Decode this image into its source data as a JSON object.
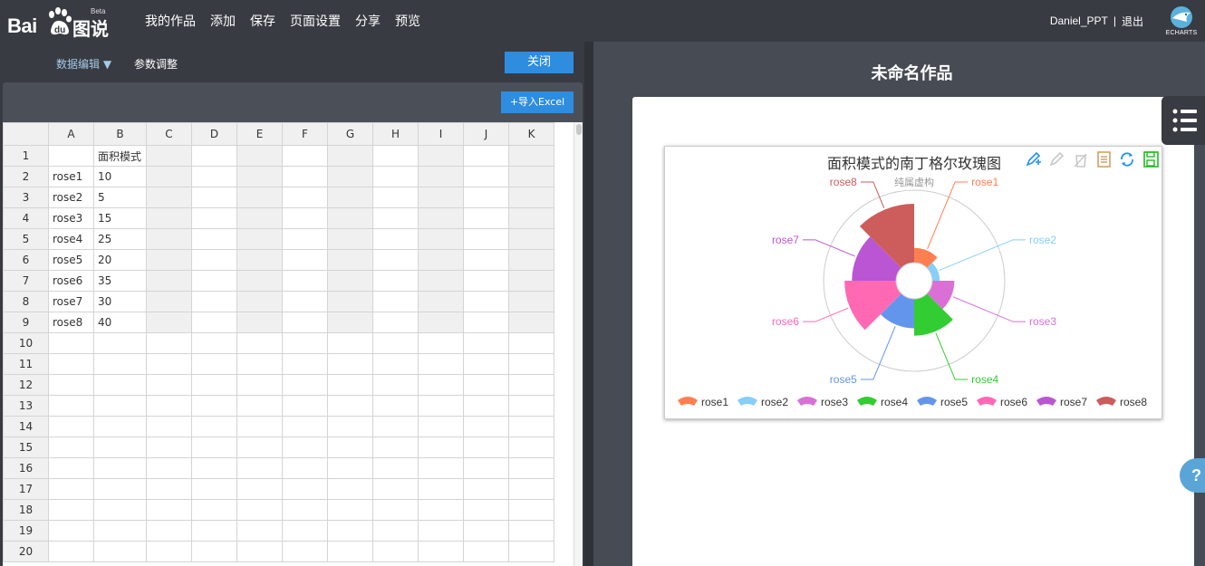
{
  "app": {
    "logo_baidu": "Bai",
    "logo_tushuo": "图说",
    "logo_beta": "Beta",
    "nav": [
      "我的作品",
      "添加",
      "保存",
      "页面设置",
      "分享",
      "预览"
    ],
    "user_name": "Daniel_PPT",
    "user_sep": "|",
    "logout_label": "退出",
    "echarts_label": "ECHARTS"
  },
  "editor": {
    "tab_data_label": "数据编辑",
    "tab_data_caret": "▼",
    "tab_param_label": "参数调整",
    "close_label": "关闭",
    "import_label": "+导入Excel"
  },
  "sheet": {
    "columns": [
      "",
      "A",
      "B",
      "C",
      "D",
      "E",
      "F",
      "G",
      "H",
      "I",
      "J",
      "K"
    ],
    "rows": [
      [
        "1",
        "",
        "面积模式"
      ],
      [
        "2",
        "rose1",
        "10"
      ],
      [
        "3",
        "rose2",
        "5"
      ],
      [
        "4",
        "rose3",
        "15"
      ],
      [
        "5",
        "rose4",
        "25"
      ],
      [
        "6",
        "rose5",
        "20"
      ],
      [
        "7",
        "rose6",
        "35"
      ],
      [
        "8",
        "rose7",
        "30"
      ],
      [
        "9",
        "rose8",
        "40"
      ],
      [
        "10",
        "",
        ""
      ],
      [
        "11",
        "",
        ""
      ],
      [
        "12",
        "",
        ""
      ],
      [
        "13",
        "",
        ""
      ],
      [
        "14",
        "",
        ""
      ],
      [
        "15",
        "",
        ""
      ],
      [
        "16",
        "",
        ""
      ],
      [
        "17",
        "",
        ""
      ],
      [
        "18",
        "",
        ""
      ],
      [
        "19",
        "",
        ""
      ],
      [
        "20",
        "",
        ""
      ]
    ]
  },
  "work": {
    "title": "未命名作品"
  },
  "chart": {
    "title": "面积模式的南丁格尔玫瑰图",
    "subtitle": "纯属虚构",
    "toolbox": [
      "mark-icon",
      "mark-undo-icon",
      "mark-clear-icon",
      "data-view-icon",
      "restore-icon",
      "save-image-icon"
    ],
    "toolbox_colors": [
      "#1e90ff",
      "#c8c8c8",
      "#c8c8c8",
      "#d2a066",
      "#1e90ff",
      "#22bb22"
    ]
  },
  "chart_data": {
    "type": "pie",
    "variant": "nightingale-area",
    "title": "面积模式的南丁格尔玫瑰图",
    "subtitle": "纯属虚构",
    "categories": [
      "rose1",
      "rose2",
      "rose3",
      "rose4",
      "rose5",
      "rose6",
      "rose7",
      "rose8"
    ],
    "values": [
      10,
      5,
      15,
      25,
      20,
      35,
      30,
      40
    ],
    "colors": [
      "#ff7f50",
      "#87cefa",
      "#da70d6",
      "#32cd32",
      "#6495ed",
      "#ff69b4",
      "#ba55d3",
      "#cd5c5c"
    ],
    "legend": "bottom"
  }
}
